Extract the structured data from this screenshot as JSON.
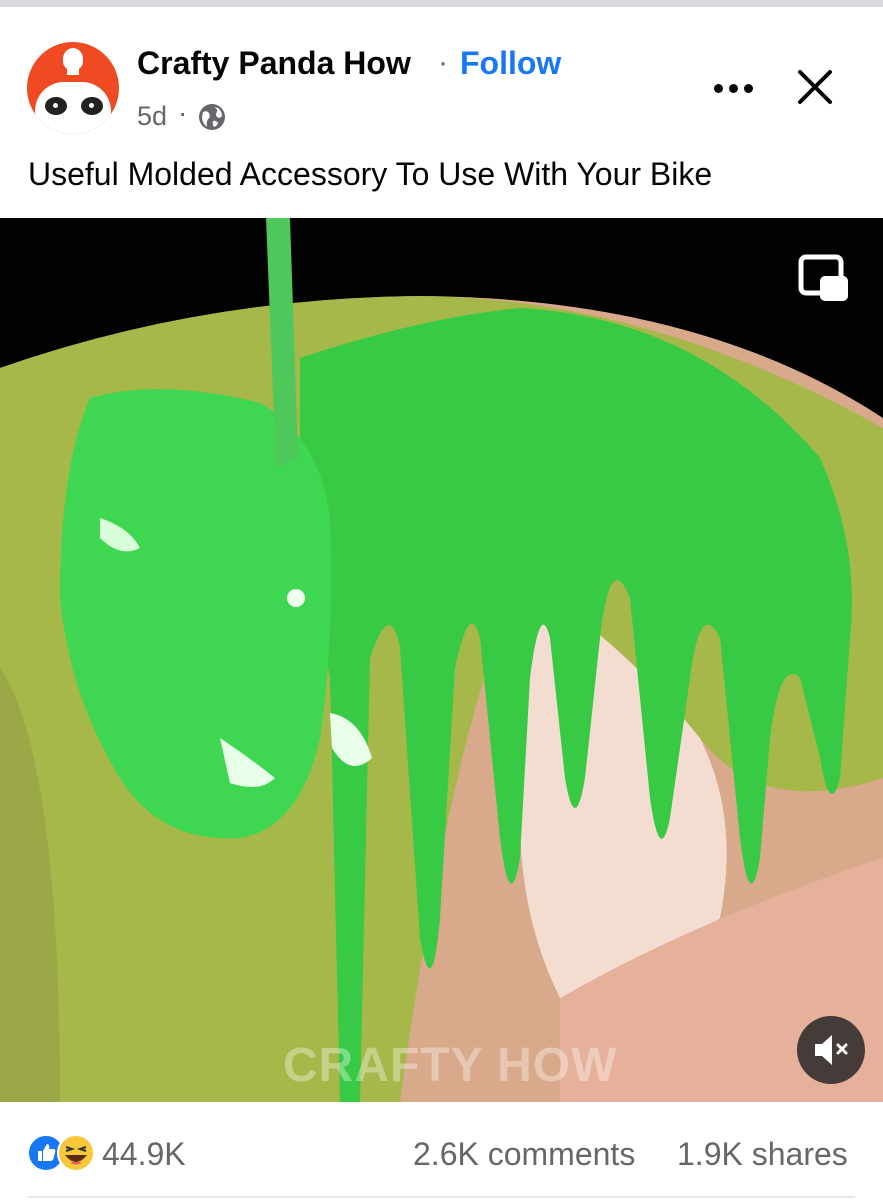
{
  "post": {
    "author": "Crafty Panda How",
    "separator": "·",
    "follow_label": "Follow",
    "time_ago": "5d",
    "time_separator": "·",
    "privacy_icon": "globe-icon",
    "caption": "Useful Molded Accessory To Use With Your Bike"
  },
  "header_actions": {
    "more_icon": "more-dots-icon",
    "close_icon": "close-icon"
  },
  "video": {
    "watermark": "CRAFTY HOW",
    "pip_icon": "picture-in-picture-icon",
    "mute_icon": "speaker-muted-icon",
    "colors": {
      "paint_green": "#3cd44a",
      "skin": "#e7a88e",
      "background": "#000000"
    }
  },
  "stats": {
    "reaction_icons": [
      "like-icon",
      "haha-icon"
    ],
    "reaction_count": "44.9K",
    "comments": "2.6K comments",
    "shares": "1.9K shares"
  },
  "colors": {
    "accent": "#1877f2",
    "text": "#050505",
    "secondary": "#65676b"
  }
}
